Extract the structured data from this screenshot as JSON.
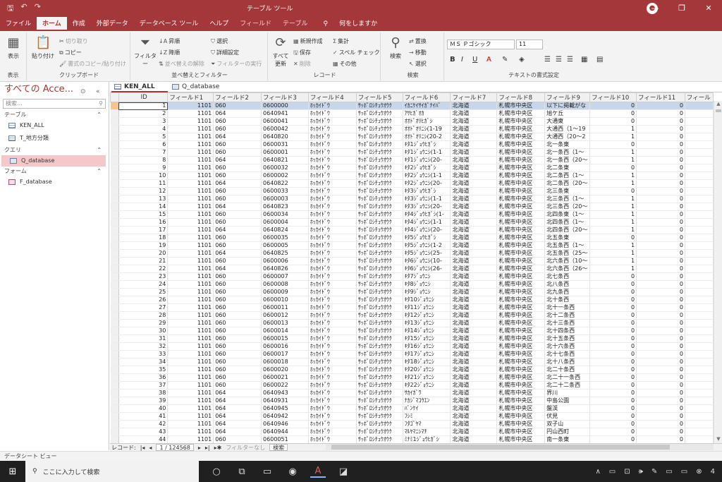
{
  "window": {
    "context_title": "テーブル ツール",
    "min": "—",
    "max": "❐",
    "close": "✕",
    "avatar": "●"
  },
  "qat": {
    "save": "🖫",
    "undo": "↶",
    "redo": "↷"
  },
  "tabs": [
    "ファイル",
    "ホーム",
    "作成",
    "外部データ",
    "データベース ツール",
    "ヘルプ",
    "フィールド",
    "テーブル"
  ],
  "tell_me": "何をしますか",
  "ribbon": {
    "view": {
      "label": "表示",
      "group": "表示"
    },
    "clipboard": {
      "paste": "貼り付け",
      "cut": "切り取り",
      "copy": "コピー",
      "format_painter": "書式のコピー/貼り付け",
      "group": "クリップボード"
    },
    "sort": {
      "filter": "フィルター",
      "asc": "昇順",
      "desc": "降順",
      "remove": "並べ替えの解除",
      "select": "選択",
      "advanced": "詳細設定",
      "toggle": "フィルターの実行",
      "group": "並べ替えとフィルター"
    },
    "records": {
      "refresh": "すべて",
      "refresh2": "更新",
      "new": "新規作成",
      "save": "保存",
      "delete": "削除",
      "totals": "集計",
      "spell": "スペル チェック",
      "more": "その他",
      "group": "レコード"
    },
    "find": {
      "find": "検索",
      "replace": "置換",
      "goto": "移動",
      "select": "選択",
      "group": "検索"
    },
    "text": {
      "font": "ＭＳ Ｐゴシック",
      "size": "11",
      "group": "テキストの書式設定",
      "bold": "B",
      "italic": "I",
      "underline": "U"
    }
  },
  "nav": {
    "title": "すべての Acce...",
    "search": "検索...",
    "sections": [
      {
        "name": "テーブル",
        "items": [
          "KEN_ALL",
          "T_地方分類"
        ]
      },
      {
        "name": "クエリ",
        "items": [
          "Q_database"
        ]
      },
      {
        "name": "フォーム",
        "items": [
          "F_database"
        ]
      }
    ]
  },
  "doc_tabs": [
    "KEN_ALL",
    "Q_database"
  ],
  "grid": {
    "columns": [
      "ID",
      "フィールド1",
      "フィールド2",
      "フィールド3",
      "フィールド4",
      "フィールド5",
      "フィールド6",
      "フィールド7",
      "フィールド8",
      "フィールド9",
      "フィールド10",
      "フィールド11",
      "フィール"
    ],
    "rows": [
      [
        "1",
        "1101",
        "060",
        "0600000",
        "ﾎｯｶｲﾄﾞｳ",
        "ｻｯﾎﾟﾛｼﾁｭｳｵｳｸ",
        "ｲｶﾆｹｲｻｲｶﾞﾅｲﾊﾞ",
        "北海道",
        "札幌市中央区",
        "以下に掲載がな",
        "0",
        "0"
      ],
      [
        "2",
        "1101",
        "064",
        "0640941",
        "ﾎｯｶｲﾄﾞｳ",
        "ｻｯﾎﾟﾛｼﾁｭｳｵｳｸ",
        "ｱｻﾋｶﾞｵｶ",
        "北海道",
        "札幌市中央区",
        "旭ケ丘",
        "0",
        "0"
      ],
      [
        "3",
        "1101",
        "060",
        "0600041",
        "ﾎｯｶｲﾄﾞｳ",
        "ｻｯﾎﾟﾛｼﾁｭｳｵｳｸ",
        "ｵｵﾄﾞｵﾘﾋｶﾞｼ",
        "北海道",
        "札幌市中央区",
        "大通東",
        "0",
        "0"
      ],
      [
        "4",
        "1101",
        "060",
        "0600042",
        "ﾎｯｶｲﾄﾞｳ",
        "ｻｯﾎﾟﾛｼﾁｭｳｵｳｸ",
        "ｵｵﾄﾞｵﾘﾆｼ(1-19",
        "北海道",
        "札幌市中央区",
        "大通西（1～19",
        "1",
        "0"
      ],
      [
        "5",
        "1101",
        "064",
        "0640820",
        "ﾎｯｶｲﾄﾞｳ",
        "ｻｯﾎﾟﾛｼﾁｭｳｵｳｸ",
        "ｵｵﾄﾞｵﾘﾆｼ(20-2",
        "北海道",
        "札幌市中央区",
        "大通西（20～2",
        "1",
        "0"
      ],
      [
        "6",
        "1101",
        "060",
        "0600031",
        "ﾎｯｶｲﾄﾞｳ",
        "ｻｯﾎﾟﾛｼﾁｭｳｵｳｸ",
        "ｷﾀ1ｼﾞｮｳﾋｶﾞｼ",
        "北海道",
        "札幌市中央区",
        "北一条東",
        "0",
        "0"
      ],
      [
        "7",
        "1101",
        "060",
        "0600001",
        "ﾎｯｶｲﾄﾞｳ",
        "ｻｯﾎﾟﾛｼﾁｭｳｵｳｸ",
        "ｷﾀ1ｼﾞｮｳﾆｼ(1-1",
        "北海道",
        "札幌市中央区",
        "北一条西（1～",
        "1",
        "0"
      ],
      [
        "8",
        "1101",
        "064",
        "0640821",
        "ﾎｯｶｲﾄﾞｳ",
        "ｻｯﾎﾟﾛｼﾁｭｳｵｳｸ",
        "ｷﾀ1ｼﾞｮｳﾆｼ(20-",
        "北海道",
        "札幌市中央区",
        "北一条西（20～",
        "1",
        "0"
      ],
      [
        "9",
        "1101",
        "060",
        "0600032",
        "ﾎｯｶｲﾄﾞｳ",
        "ｻｯﾎﾟﾛｼﾁｭｳｵｳｸ",
        "ｷﾀ2ｼﾞｮｳﾋｶﾞｼ",
        "北海道",
        "札幌市中央区",
        "北二条東",
        "0",
        "0"
      ],
      [
        "10",
        "1101",
        "060",
        "0600002",
        "ﾎｯｶｲﾄﾞｳ",
        "ｻｯﾎﾟﾛｼﾁｭｳｵｳｸ",
        "ｷﾀ2ｼﾞｮｳﾆｼ(1-1",
        "北海道",
        "札幌市中央区",
        "北二条西（1～",
        "1",
        "0"
      ],
      [
        "11",
        "1101",
        "064",
        "0640822",
        "ﾎｯｶｲﾄﾞｳ",
        "ｻｯﾎﾟﾛｼﾁｭｳｵｳｸ",
        "ｷﾀ2ｼﾞｮｳﾆｼ(20-",
        "北海道",
        "札幌市中央区",
        "北二条西（20～",
        "1",
        "0"
      ],
      [
        "12",
        "1101",
        "060",
        "0600033",
        "ﾎｯｶｲﾄﾞｳ",
        "ｻｯﾎﾟﾛｼﾁｭｳｵｳｸ",
        "ｷﾀ3ｼﾞｮｳﾋｶﾞｼ",
        "北海道",
        "札幌市中央区",
        "北三条東",
        "0",
        "0"
      ],
      [
        "13",
        "1101",
        "060",
        "0600003",
        "ﾎｯｶｲﾄﾞｳ",
        "ｻｯﾎﾟﾛｼﾁｭｳｵｳｸ",
        "ｷﾀ3ｼﾞｮｳﾆｼ(1-1",
        "北海道",
        "札幌市中央区",
        "北三条西（1～",
        "1",
        "0"
      ],
      [
        "14",
        "1101",
        "064",
        "0640823",
        "ﾎｯｶｲﾄﾞｳ",
        "ｻｯﾎﾟﾛｼﾁｭｳｵｳｸ",
        "ｷﾀ3ｼﾞｮｳﾆｼ(20-",
        "北海道",
        "札幌市中央区",
        "北三条西（20～",
        "1",
        "0"
      ],
      [
        "15",
        "1101",
        "060",
        "0600034",
        "ﾎｯｶｲﾄﾞｳ",
        "ｻｯﾎﾟﾛｼﾁｭｳｵｳｸ",
        "ｷﾀ4ｼﾞｮｳﾋｶﾞｼ(1-",
        "北海道",
        "札幌市中央区",
        "北四条東（1～",
        "1",
        "0"
      ],
      [
        "16",
        "1101",
        "060",
        "0600004",
        "ﾎｯｶｲﾄﾞｳ",
        "ｻｯﾎﾟﾛｼﾁｭｳｵｳｸ",
        "ｷﾀ4ｼﾞｮｳﾆｼ(1-1",
        "北海道",
        "札幌市中央区",
        "北四条西（1～",
        "1",
        "0"
      ],
      [
        "17",
        "1101",
        "064",
        "0640824",
        "ﾎｯｶｲﾄﾞｳ",
        "ｻｯﾎﾟﾛｼﾁｭｳｵｳｸ",
        "ｷﾀ4ｼﾞｮｳﾆｼ(20-",
        "北海道",
        "札幌市中央区",
        "北四条西（20～",
        "1",
        "0"
      ],
      [
        "18",
        "1101",
        "060",
        "0600035",
        "ﾎｯｶｲﾄﾞｳ",
        "ｻｯﾎﾟﾛｼﾁｭｳｵｳｸ",
        "ｷﾀ5ｼﾞｮｳﾋｶﾞｼ",
        "北海道",
        "札幌市中央区",
        "北五条東",
        "0",
        "0"
      ],
      [
        "19",
        "1101",
        "060",
        "0600005",
        "ﾎｯｶｲﾄﾞｳ",
        "ｻｯﾎﾟﾛｼﾁｭｳｵｳｸ",
        "ｷﾀ5ｼﾞｮｳﾆｼ(1-2",
        "北海道",
        "札幌市中央区",
        "北五条西（1～",
        "1",
        "0"
      ],
      [
        "20",
        "1101",
        "064",
        "0640825",
        "ﾎｯｶｲﾄﾞｳ",
        "ｻｯﾎﾟﾛｼﾁｭｳｵｳｸ",
        "ｷﾀ5ｼﾞｮｳﾆｼ(25-",
        "北海道",
        "札幌市中央区",
        "北五条西（25～",
        "1",
        "0"
      ],
      [
        "21",
        "1101",
        "060",
        "0600006",
        "ﾎｯｶｲﾄﾞｳ",
        "ｻｯﾎﾟﾛｼﾁｭｳｵｳｸ",
        "ｷﾀ6ｼﾞｮｳﾆｼ(10-",
        "北海道",
        "札幌市中央区",
        "北六条西（10～",
        "1",
        "0"
      ],
      [
        "22",
        "1101",
        "064",
        "0640826",
        "ﾎｯｶｲﾄﾞｳ",
        "ｻｯﾎﾟﾛｼﾁｭｳｵｳｸ",
        "ｷﾀ6ｼﾞｮｳﾆｼ(26-",
        "北海道",
        "札幌市中央区",
        "北六条西（26～",
        "1",
        "0"
      ],
      [
        "23",
        "1101",
        "060",
        "0600007",
        "ﾎｯｶｲﾄﾞｳ",
        "ｻｯﾎﾟﾛｼﾁｭｳｵｳｸ",
        "ｷﾀ7ｼﾞｮｳﾆｼ",
        "北海道",
        "札幌市中央区",
        "北七条西",
        "0",
        "0"
      ],
      [
        "24",
        "1101",
        "060",
        "0600008",
        "ﾎｯｶｲﾄﾞｳ",
        "ｻｯﾎﾟﾛｼﾁｭｳｵｳｸ",
        "ｷﾀ8ｼﾞｮｳﾆｼ",
        "北海道",
        "札幌市中央区",
        "北八条西",
        "0",
        "0"
      ],
      [
        "25",
        "1101",
        "060",
        "0600009",
        "ﾎｯｶｲﾄﾞｳ",
        "ｻｯﾎﾟﾛｼﾁｭｳｵｳｸ",
        "ｷﾀ9ｼﾞｮｳﾆｼ",
        "北海道",
        "札幌市中央区",
        "北九条西",
        "0",
        "0"
      ],
      [
        "26",
        "1101",
        "060",
        "0600010",
        "ﾎｯｶｲﾄﾞｳ",
        "ｻｯﾎﾟﾛｼﾁｭｳｵｳｸ",
        "ｷﾀ10ｼﾞｮｳﾆｼ",
        "北海道",
        "札幌市中央区",
        "北十条西",
        "0",
        "0"
      ],
      [
        "27",
        "1101",
        "060",
        "0600011",
        "ﾎｯｶｲﾄﾞｳ",
        "ｻｯﾎﾟﾛｼﾁｭｳｵｳｸ",
        "ｷﾀ11ｼﾞｮｳﾆｼ",
        "北海道",
        "札幌市中央区",
        "北十一条西",
        "0",
        "0"
      ],
      [
        "28",
        "1101",
        "060",
        "0600012",
        "ﾎｯｶｲﾄﾞｳ",
        "ｻｯﾎﾟﾛｼﾁｭｳｵｳｸ",
        "ｷﾀ12ｼﾞｮｳﾆｼ",
        "北海道",
        "札幌市中央区",
        "北十二条西",
        "0",
        "0"
      ],
      [
        "29",
        "1101",
        "060",
        "0600013",
        "ﾎｯｶｲﾄﾞｳ",
        "ｻｯﾎﾟﾛｼﾁｭｳｵｳｸ",
        "ｷﾀ13ｼﾞｮｳﾆｼ",
        "北海道",
        "札幌市中央区",
        "北十三条西",
        "0",
        "0"
      ],
      [
        "30",
        "1101",
        "060",
        "0600014",
        "ﾎｯｶｲﾄﾞｳ",
        "ｻｯﾎﾟﾛｼﾁｭｳｵｳｸ",
        "ｷﾀ14ｼﾞｮｳﾆｼ",
        "北海道",
        "札幌市中央区",
        "北十四条西",
        "0",
        "0"
      ],
      [
        "31",
        "1101",
        "060",
        "0600015",
        "ﾎｯｶｲﾄﾞｳ",
        "ｻｯﾎﾟﾛｼﾁｭｳｵｳｸ",
        "ｷﾀ15ｼﾞｮｳﾆｼ",
        "北海道",
        "札幌市中央区",
        "北十五条西",
        "0",
        "0"
      ],
      [
        "32",
        "1101",
        "060",
        "0600016",
        "ﾎｯｶｲﾄﾞｳ",
        "ｻｯﾎﾟﾛｼﾁｭｳｵｳｸ",
        "ｷﾀ16ｼﾞｮｳﾆｼ",
        "北海道",
        "札幌市中央区",
        "北十六条西",
        "0",
        "0"
      ],
      [
        "33",
        "1101",
        "060",
        "0600017",
        "ﾎｯｶｲﾄﾞｳ",
        "ｻｯﾎﾟﾛｼﾁｭｳｵｳｸ",
        "ｷﾀ17ｼﾞｮｳﾆｼ",
        "北海道",
        "札幌市中央区",
        "北十七条西",
        "0",
        "0"
      ],
      [
        "34",
        "1101",
        "060",
        "0600018",
        "ﾎｯｶｲﾄﾞｳ",
        "ｻｯﾎﾟﾛｼﾁｭｳｵｳｸ",
        "ｷﾀ18ｼﾞｮｳﾆｼ",
        "北海道",
        "札幌市中央区",
        "北十八条西",
        "0",
        "0"
      ],
      [
        "35",
        "1101",
        "060",
        "0600020",
        "ﾎｯｶｲﾄﾞｳ",
        "ｻｯﾎﾟﾛｼﾁｭｳｵｳｸ",
        "ｷﾀ20ｼﾞｮｳﾆｼ",
        "北海道",
        "札幌市中央区",
        "北二十条西",
        "0",
        "0"
      ],
      [
        "36",
        "1101",
        "060",
        "0600021",
        "ﾎｯｶｲﾄﾞｳ",
        "ｻｯﾎﾟﾛｼﾁｭｳｵｳｸ",
        "ｷﾀ21ｼﾞｮｳﾆｼ",
        "北海道",
        "札幌市中央区",
        "北二十一条西",
        "0",
        "0"
      ],
      [
        "37",
        "1101",
        "060",
        "0600022",
        "ﾎｯｶｲﾄﾞｳ",
        "ｻｯﾎﾟﾛｼﾁｭｳｵｳｸ",
        "ｷﾀ22ｼﾞｮｳﾆｼ",
        "北海道",
        "札幌市中央区",
        "北二十二条西",
        "0",
        "0"
      ],
      [
        "38",
        "1101",
        "064",
        "0640943",
        "ﾎｯｶｲﾄﾞｳ",
        "ｻｯﾎﾟﾛｼﾁｭｳｵｳｸ",
        "ｻｶｲｶﾞﾜ",
        "北海道",
        "札幌市中央区",
        "界川",
        "0",
        "0"
      ],
      [
        "39",
        "1101",
        "064",
        "0640931",
        "ﾎｯｶｲﾄﾞｳ",
        "ｻｯﾎﾟﾛｼﾁｭｳｵｳｸ",
        "ﾅｶｼﾞﾏｺｳｴﾝ",
        "北海道",
        "札幌市中央区",
        "中島公園",
        "0",
        "0"
      ],
      [
        "40",
        "1101",
        "064",
        "0640945",
        "ﾎｯｶｲﾄﾞｳ",
        "ｻｯﾎﾟﾛｼﾁｭｳｵｳｸ",
        "ﾊﾞﾝｹｲ",
        "北海道",
        "札幌市中央区",
        "盤渓",
        "0",
        "0"
      ],
      [
        "41",
        "1101",
        "064",
        "0640942",
        "ﾎｯｶｲﾄﾞｳ",
        "ｻｯﾎﾟﾛｼﾁｭｳｵｳｸ",
        "ﾌｼﾐ",
        "北海道",
        "札幌市中央区",
        "伏見",
        "0",
        "0"
      ],
      [
        "42",
        "1101",
        "064",
        "0640946",
        "ﾎｯｶｲﾄﾞｳ",
        "ｻｯﾎﾟﾛｼﾁｭｳｵｳｸ",
        "ﾌﾀｺﾞﾔﾏ",
        "北海道",
        "札幌市中央区",
        "双子山",
        "0",
        "0"
      ],
      [
        "43",
        "1101",
        "064",
        "0640944",
        "ﾎｯｶｲﾄﾞｳ",
        "ｻｯﾎﾟﾛｼﾁｭｳｵｳｸ",
        "ﾏﾙﾔﾏﾆｼﾏﾁ",
        "北海道",
        "札幌市中央区",
        "円山西町",
        "0",
        "0"
      ],
      [
        "44",
        "1101",
        "060",
        "0600051",
        "ﾎｯｶｲﾄﾞｳ",
        "ｻｯﾎﾟﾛｼﾁｭｳｵｳｸ",
        "ﾐﾅﾐ1ｼﾞｮｳﾋｶﾞｼ",
        "北海道",
        "札幌市中央区",
        "南一条東",
        "0",
        "0"
      ]
    ]
  },
  "record_bar": {
    "label": "レコード:",
    "first": "|◂",
    "prev": "◂",
    "current": "1 / 124568",
    "next": "▸",
    "last": "▸|",
    "new": "▸✱",
    "filter": "フィルターなし",
    "search": "検索"
  },
  "status": "データシート ビュー",
  "taskbar": {
    "start": "⊞",
    "search": "ここに入力して検索",
    "apps": [
      "○",
      "⧉",
      "▭",
      "◉",
      "A",
      "◪"
    ],
    "tray": [
      "∧",
      "▭",
      "⊡",
      "🕪",
      "✎",
      "▭",
      "▭",
      "⊗",
      "4"
    ]
  }
}
